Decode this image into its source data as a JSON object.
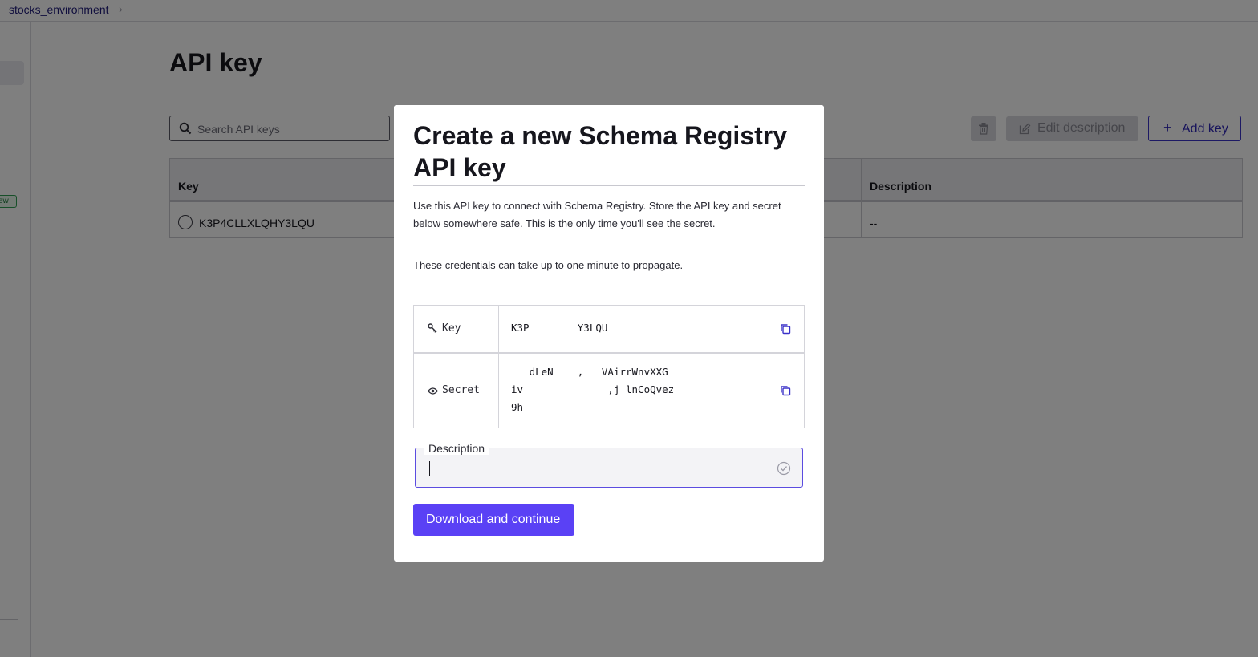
{
  "breadcrumb": {
    "environment": "stocks_environment",
    "chevron": "chevron-right-icon"
  },
  "nav": {
    "badge": "ew"
  },
  "page": {
    "title": "API key",
    "search_placeholder": "Search API keys",
    "toolbar": {
      "trash_icon": "trash-icon",
      "edit_label": "Edit description",
      "add_label": "Add key"
    },
    "table": {
      "columns": [
        "Key",
        "Description"
      ],
      "rows": [
        {
          "key": "K3P4CLLXLQHY3LQU",
          "description": "--"
        }
      ]
    }
  },
  "modal": {
    "title": "Create a new Schema Registry API key",
    "body_line1": "Use this API key to connect with Schema Registry. Store the API key and secret below somewhere safe. This is the only time you'll see the secret.",
    "body_line2": "These credentials can take up to one minute to propagate.",
    "credentials": {
      "key_label": "Key",
      "key_value": "K3P        Y3LQU",
      "secret_label": "Secret",
      "secret_line1": "   dLeN    ,   VAirrWnvXXG",
      "secret_line2": "iv              ,j lnCoQvez",
      "secret_line3": "9h"
    },
    "description_field": {
      "label": "Description",
      "value": ""
    },
    "primary_button": "Download and continue"
  },
  "colors": {
    "accent": "#5a41f5",
    "link": "#1f1a7a",
    "overlay": "rgba(0,0,0,0.5)"
  }
}
